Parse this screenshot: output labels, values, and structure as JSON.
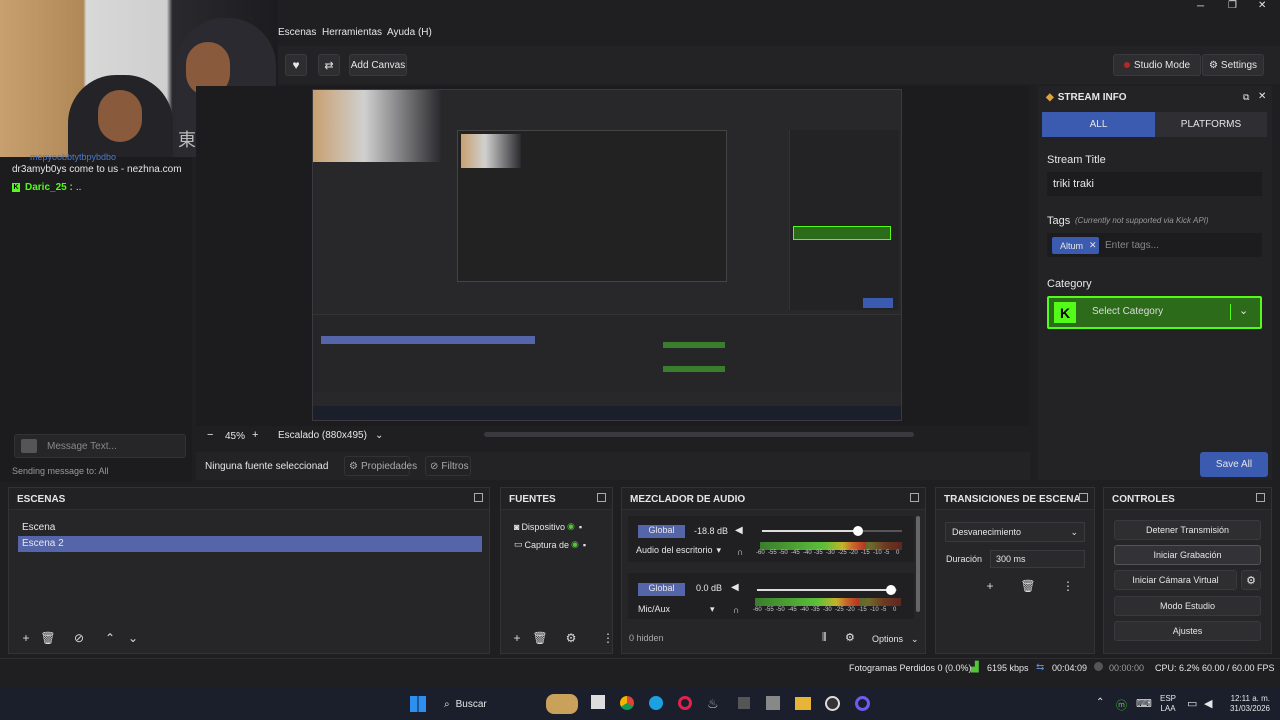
{
  "menu": {
    "scenes": "Escenas",
    "tools": "Herramientas",
    "help": "Ayuda (H)"
  },
  "window_controls": {
    "minimize": "─",
    "maximize": "❐",
    "close": "✕"
  },
  "toolbar": {
    "add_canvas": "Add Canvas",
    "studio_mode": "Studio Mode",
    "settings": "Settings"
  },
  "chat": {
    "partial_line": "mepyoobbtytbpybdbo",
    "line1": "dr3amyb0ys come to us - nezhna.com",
    "line2_user": "Daric_25 :",
    "line2_text": "..",
    "message_placeholder": "Message Text...",
    "sending_to": "Sending message to: All"
  },
  "preview": {
    "zoom_minus": "−",
    "zoom_value": "45%",
    "zoom_plus": "+",
    "scaling": "Escalado (880x495)",
    "no_source": "Ninguna fuente seleccionad",
    "properties": "Propiedades",
    "filters": "Filtros",
    "webcam_text": "東京日本"
  },
  "stream_info": {
    "title": "STREAM INFO",
    "tab_all": "ALL",
    "tab_platforms": "PLATFORMS",
    "stream_title_label": "Stream Title",
    "stream_title_value": "triki traki",
    "tags_label": "Tags",
    "tags_note": "(Currently not supported via Kick API)",
    "tag": "Altum",
    "tags_placeholder": "Enter tags...",
    "category_label": "Category",
    "category_placeholder": "Select Category",
    "kick_letter": "K",
    "save_all": "Save All"
  },
  "scenes_dock": {
    "title": "ESCENAS",
    "items": [
      "Escena",
      "Escena 2"
    ],
    "selected": 1
  },
  "sources_dock": {
    "title": "FUENTES",
    "items": [
      "Dispositivo",
      "Captura de"
    ]
  },
  "mixer_dock": {
    "title": "MEZCLADOR DE AUDIO",
    "channels": [
      {
        "badge": "Global",
        "db": "-18.8 dB",
        "name": "Audio del escritorio",
        "volume": 0.72
      },
      {
        "badge": "Global",
        "db": "0.0 dB",
        "name": "Mic/Aux",
        "volume": 1.0
      }
    ],
    "scale": [
      "-60",
      "-55",
      "-50",
      "-45",
      "-40",
      "-35",
      "-30",
      "-25",
      "-20",
      "-15",
      "-10",
      "-5",
      "0"
    ],
    "hidden": "0 hidden",
    "options": "Options"
  },
  "transitions_dock": {
    "title": "TRANSICIONES DE ESCENA",
    "transition": "Desvanecimiento",
    "duration_label": "Duración",
    "duration_value": "300 ms"
  },
  "controls_dock": {
    "title": "CONTROLES",
    "buttons": [
      "Detener Transmisión",
      "Iniciar Grabación",
      "Iniciar Cámara Virtual",
      "Modo Estudio",
      "Ajustes"
    ]
  },
  "status_bar": {
    "dropped_frames": "Fotogramas Perdidos 0 (0.0%)",
    "bitrate": "6195 kbps",
    "stream_time": "00:04:09",
    "record_time": "00:00:00",
    "cpu": "CPU: 6.2%",
    "fps": "60.00 / 60.00 FPS"
  },
  "taskbar": {
    "search": "Buscar",
    "lang_top": "ESP",
    "lang_bottom": "LAA",
    "time": "12:11 a. m.",
    "date": "31/03/2026"
  },
  "colors": {
    "accent_blue": "#3b5bb0",
    "kick_green": "#53fc18",
    "selection": "#5565a9",
    "taskbar": "#1a1f2b"
  }
}
